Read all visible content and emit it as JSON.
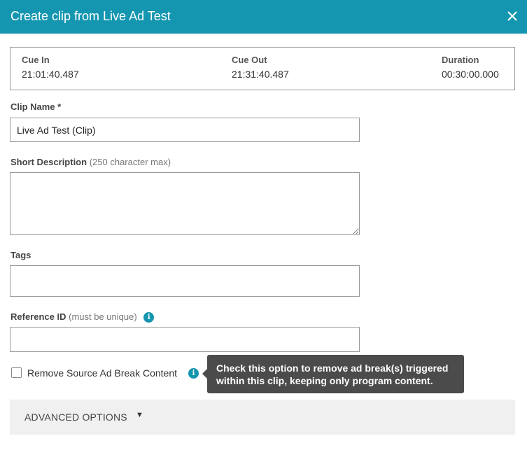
{
  "dialog": {
    "title": "Create clip from Live Ad Test",
    "close_icon": "close-icon"
  },
  "cue": {
    "in_label": "Cue In",
    "in_value": "21:01:40.487",
    "out_label": "Cue Out",
    "out_value": "21:31:40.487",
    "duration_label": "Duration",
    "duration_value": "00:30:00.000"
  },
  "fields": {
    "clip_name_label": "Clip Name *",
    "clip_name_value": "Live Ad Test (Clip)",
    "short_desc_label": "Short Description",
    "short_desc_hint": "(250 character max)",
    "short_desc_value": "",
    "tags_label": "Tags",
    "tags_value": "",
    "reference_id_label": "Reference ID",
    "reference_id_hint": "(must be unique)",
    "reference_id_value": ""
  },
  "remove_ad": {
    "label": "Remove Source Ad Break Content",
    "checked": false,
    "tooltip": "Check this option to remove ad break(s) triggered within this clip, keeping only program content."
  },
  "advanced": {
    "label": "ADVANCED OPTIONS",
    "caret": "▼"
  },
  "colors": {
    "header": "#1596b0",
    "tooltip_bg": "#4b4b4b",
    "advanced_bg": "#f0f0f0"
  }
}
